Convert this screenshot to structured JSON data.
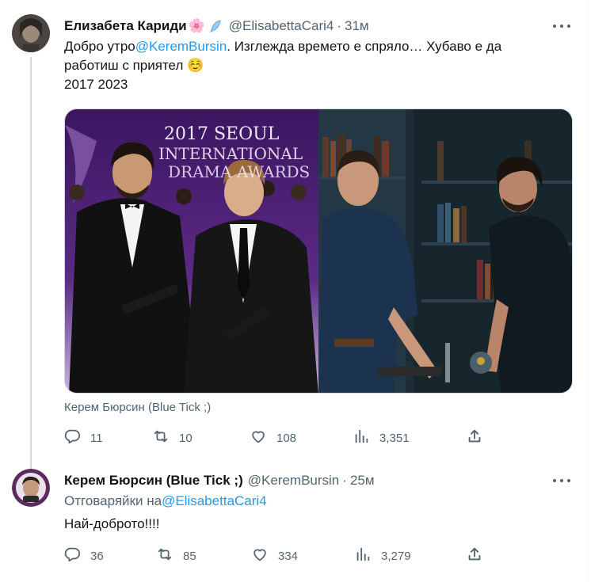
{
  "tweet1": {
    "author_name": "Елизабета Кариди",
    "author_emojis": "🌸",
    "handle": "@ElisabettaCari4",
    "time": "31м",
    "text_before": "Добро утро",
    "mention": "@KeremBursin",
    "text_after": ". Изглежда времето е спряло… Хубаво е да",
    "line2": "работиш с приятел",
    "line2_emoji": "☺️",
    "line3": "2017 2023",
    "media_banner": "2017 SEOUL INTERNATIONAL DRAMA AWARDS",
    "card_title": "Керем Бюрсин (Blue Tick ;)",
    "replies": "11",
    "reposts": "10",
    "likes": "108",
    "views": "3,351"
  },
  "tweet2": {
    "author_name": "Керем Бюрсин (Blue Tick ;)",
    "handle": "@KeremBursin",
    "time": "25м",
    "reply_prefix": "Отговаряйки на",
    "reply_mention": "@ElisabettaCari4",
    "text": "Най-доброто!!!!",
    "replies": "36",
    "reposts": "85",
    "likes": "334",
    "views": "3,279"
  },
  "icons": {
    "more": "more-dots-icon",
    "reply": "reply-bubble-icon",
    "repost": "repost-arrows-icon",
    "like": "heart-icon",
    "views": "bar-chart-icon",
    "share": "share-upload-icon"
  },
  "colors": {
    "text": "#0f1419",
    "secondary": "#536471",
    "link": "#1d9bf0",
    "border": "#cfd9de"
  }
}
